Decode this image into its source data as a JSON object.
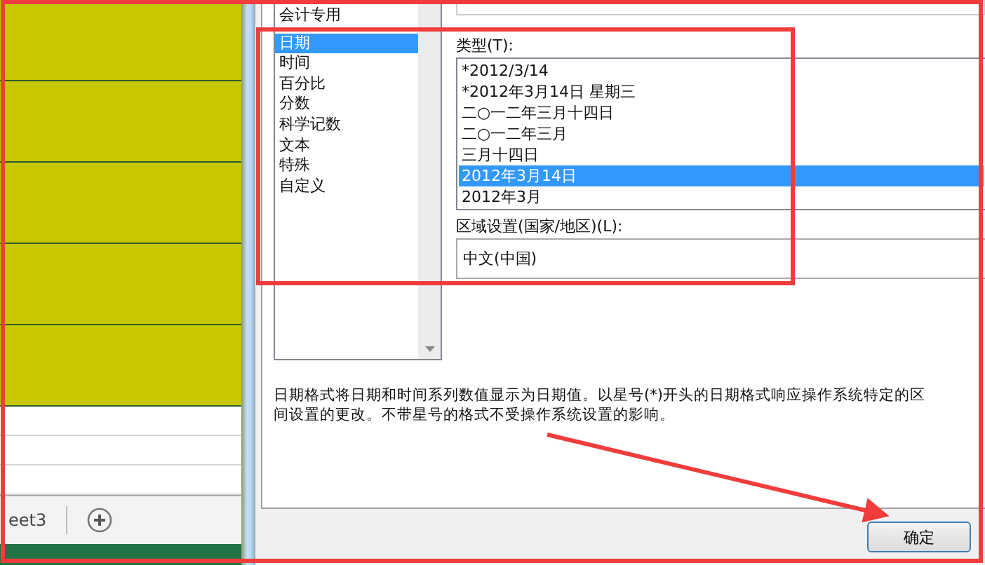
{
  "spreadsheet": {
    "sheet_tab": "eet3"
  },
  "dialog": {
    "category_list": [
      {
        "label": "会计专用",
        "selected": false
      },
      {
        "label": "日期",
        "selected": true
      },
      {
        "label": "时间",
        "selected": false
      },
      {
        "label": "百分比",
        "selected": false
      },
      {
        "label": "分数",
        "selected": false
      },
      {
        "label": "科学记数",
        "selected": false
      },
      {
        "label": "文本",
        "selected": false
      },
      {
        "label": "特殊",
        "selected": false
      },
      {
        "label": "自定义",
        "selected": false
      }
    ],
    "type_label": "类型(T):",
    "type_list": [
      {
        "label": "*2012/3/14",
        "selected": false
      },
      {
        "label": "*2012年3月14日 星期三",
        "selected": false
      },
      {
        "label": "二○一二年三月十四日",
        "selected": false
      },
      {
        "label": "二○一二年三月",
        "selected": false
      },
      {
        "label": "三月十四日",
        "selected": false
      },
      {
        "label": "2012年3月14日",
        "selected": true
      },
      {
        "label": "2012年3月",
        "selected": false
      }
    ],
    "region_label": "区域设置(国家/地区)(L):",
    "region_value": "中文(中国)",
    "description": [
      "日期格式将日期和时间系列数值显示为日期值。以星号(*)开头的日期格式响应操作系统特定的区",
      "间设置的更改。不带星号的格式不受操作系统设置的影响。"
    ],
    "ok_button": "确定"
  }
}
